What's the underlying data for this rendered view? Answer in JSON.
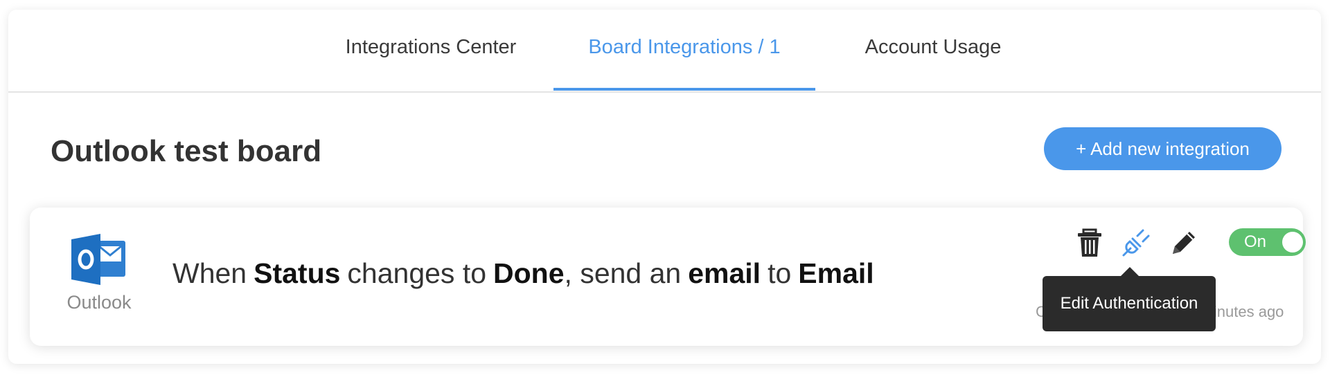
{
  "tabs": [
    {
      "label": "Integrations Center",
      "active": false
    },
    {
      "label": "Board Integrations / 1",
      "active": true
    },
    {
      "label": "Account Usage",
      "active": false
    }
  ],
  "board": {
    "title": "Outlook test board",
    "add_button_label": "+ Add new integration"
  },
  "integration": {
    "app_name": "Outlook",
    "app_icon": "outlook-icon",
    "recipe": {
      "w1": "When",
      "column": "Status",
      "w2": "changes to",
      "value": "Done",
      "w3": ", send an",
      "action": "email",
      "w4": "to",
      "target": "Email"
    },
    "actions": {
      "delete_icon": "trash-icon",
      "auth_icon": "plug-icon",
      "edit_icon": "pencil-icon"
    },
    "toggle": {
      "label": "On",
      "state": true
    },
    "meta_start": "C",
    "meta_end": "inutes ago",
    "tooltip": "Edit Authentication"
  },
  "colors": {
    "accent": "#4a97ea",
    "toggle_on": "#5ec16f",
    "tooltip_bg": "#2b2b2b",
    "outlook_blue": "#1e6fc1"
  }
}
